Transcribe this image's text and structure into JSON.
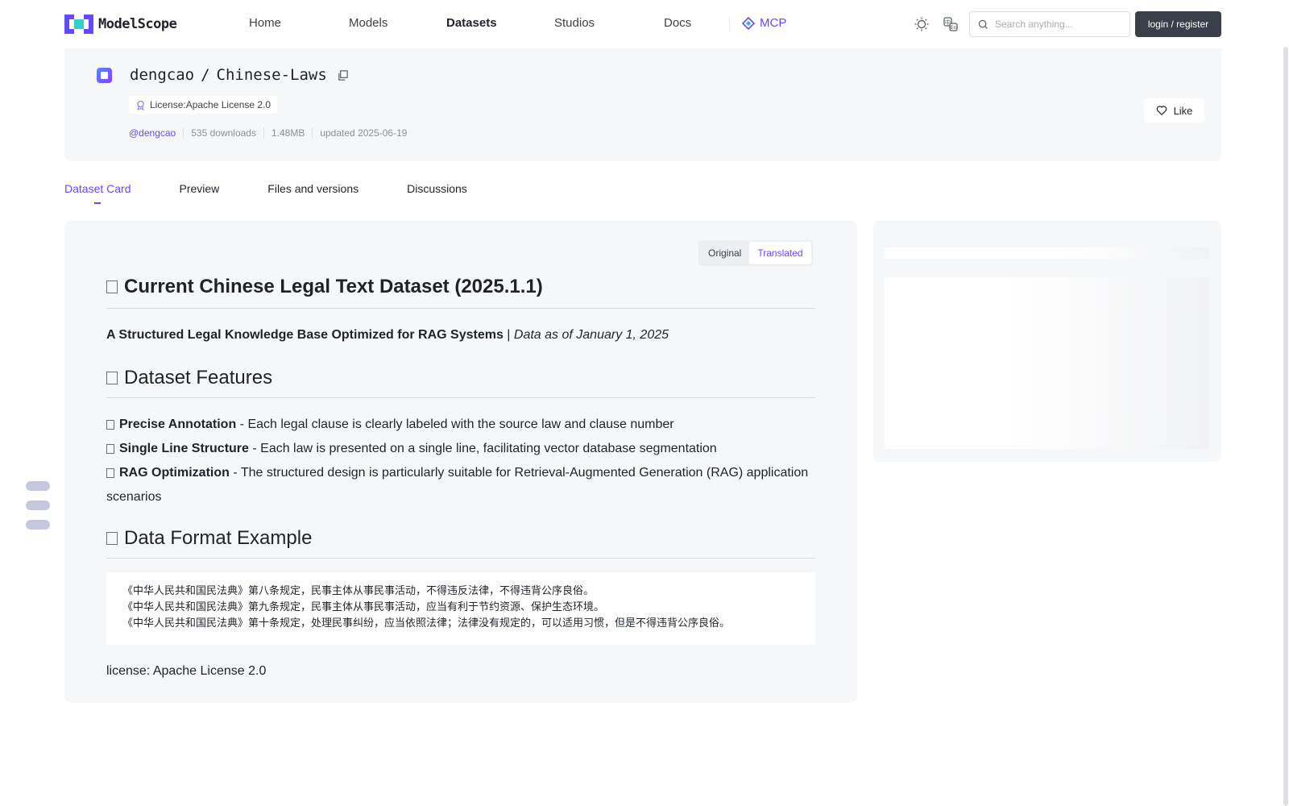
{
  "nav": {
    "logo_text": "ModelScope",
    "links": [
      "Home",
      "Models",
      "Datasets",
      "Studios",
      "Docs"
    ],
    "mcp_label": "MCP",
    "search_placeholder": "Search anything...",
    "login_label": "login / register"
  },
  "dataset": {
    "owner": "dengcao",
    "separator": "/",
    "name": "Chinese-Laws",
    "license_tag": "License:Apache License 2.0",
    "author_handle": "@dengcao",
    "downloads": "535 downloads",
    "size": "1.48MB",
    "updated": "updated 2025-06-19",
    "like_label": "Like"
  },
  "tabs": [
    "Dataset Card",
    "Preview",
    "Files and versions",
    "Discussions"
  ],
  "toggle": {
    "original": "Original",
    "translated": "Translated"
  },
  "card": {
    "title": "Current Chinese Legal Text Dataset (2025.1.1)",
    "subtitle_bold": "A Structured Legal Knowledge Base Optimized for RAG Systems",
    "subtitle_sep": " | ",
    "subtitle_italic": "Data as of January 1, 2025",
    "features_heading": "Dataset Features",
    "features": [
      {
        "bold": "Precise Annotation",
        "text": " - Each legal clause is clearly labeled with the source law and clause number"
      },
      {
        "bold": "Single Line Structure",
        "text": " - Each law is presented on a single line, facilitating vector database segmentation"
      },
      {
        "bold": "RAG Optimization",
        "text": " - The structured design is particularly suitable for Retrieval-Augmented Generation (RAG) application scenarios"
      }
    ],
    "format_heading": "Data Format Example",
    "code_lines": [
      "《中华人民共和国民法典》第八条规定，民事主体从事民事活动，不得违反法律，不得违背公序良俗。",
      "《中华人民共和国民法典》第九条规定，民事主体从事民事活动，应当有利于节约资源、保护生态环境。",
      "《中华人民共和国民法典》第十条规定，处理民事纠纷，应当依照法律；法律没有规定的，可以适用习惯，但是不得违背公序良俗。"
    ],
    "license_line": "license: Apache License 2.0"
  },
  "colors": {
    "accent": "#624aff",
    "login_bg": "#3a3f4a",
    "panel_bg": "#f6f7f9"
  }
}
